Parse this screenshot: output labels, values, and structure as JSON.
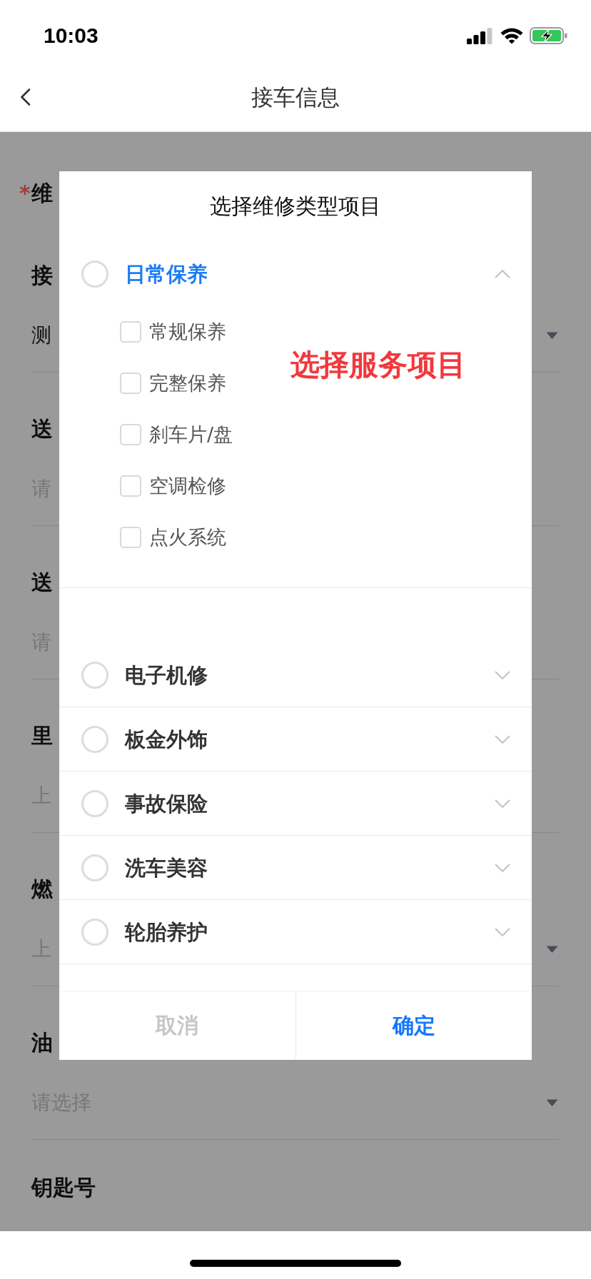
{
  "status_bar": {
    "time": "10:03"
  },
  "nav": {
    "title": "接车信息"
  },
  "form": {
    "sections": [
      {
        "label": "维",
        "required_mark": "*"
      },
      {
        "label": "接",
        "field": {
          "kind": "select",
          "value": "测"
        }
      },
      {
        "label": "送",
        "field": {
          "kind": "input",
          "placeholder": "请"
        }
      },
      {
        "label": "送",
        "field": {
          "kind": "input",
          "placeholder": "请"
        }
      },
      {
        "label": "里",
        "field": {
          "kind": "input",
          "placeholder": "上"
        }
      },
      {
        "label": "燃",
        "field": {
          "kind": "select",
          "placeholder": "上"
        }
      },
      {
        "label": "油",
        "field": {
          "kind": "select",
          "placeholder": "请选择"
        }
      },
      {
        "label": "钥匙号"
      }
    ]
  },
  "dialog": {
    "title": "选择维修类型项目",
    "groups": [
      {
        "label": "日常保养",
        "selected": false,
        "expanded": true,
        "children": [
          {
            "label": "常规保养",
            "checked": false
          },
          {
            "label": "完整保养",
            "checked": false
          },
          {
            "label": "刹车片/盘",
            "checked": false
          },
          {
            "label": "空调检修",
            "checked": false
          },
          {
            "label": "点火系统",
            "checked": false
          }
        ]
      },
      {
        "label": "电子机修",
        "selected": false,
        "expanded": false
      },
      {
        "label": "板金外饰",
        "selected": false,
        "expanded": false
      },
      {
        "label": "事故保险",
        "selected": false,
        "expanded": false
      },
      {
        "label": "洗车美容",
        "selected": false,
        "expanded": false
      },
      {
        "label": "轮胎养护",
        "selected": false,
        "expanded": false
      }
    ],
    "buttons": [
      {
        "kind": "cancel",
        "label": "取消"
      },
      {
        "kind": "confirm",
        "label": "确定"
      }
    ]
  },
  "annotation": {
    "text": "选择服务项目"
  }
}
